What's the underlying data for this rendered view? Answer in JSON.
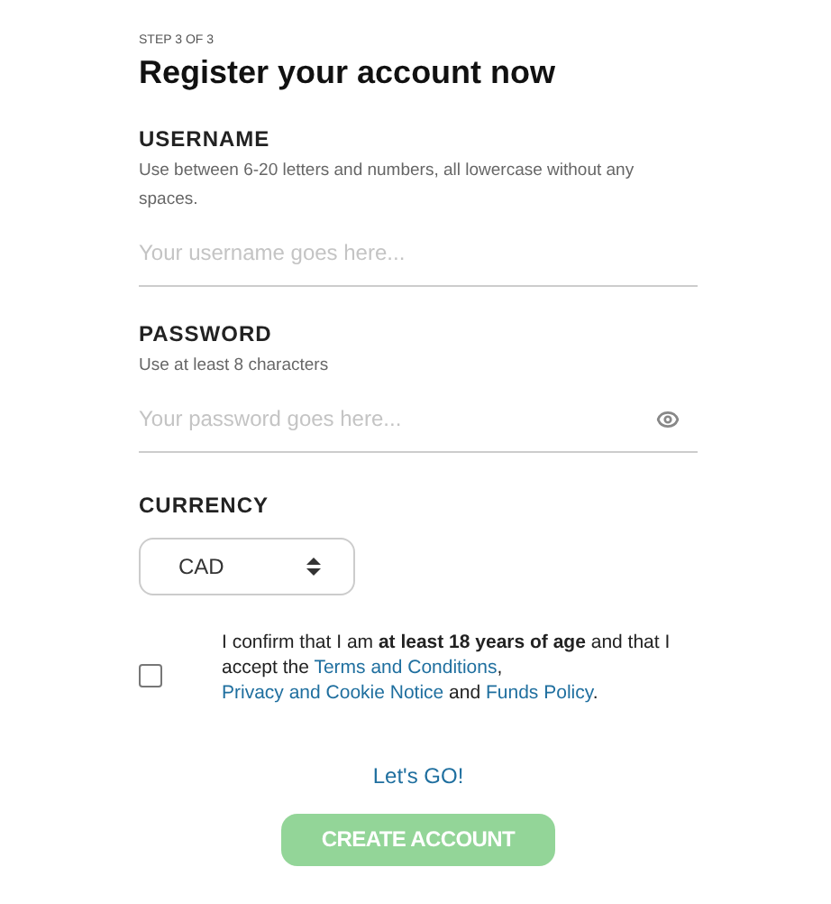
{
  "step": "STEP 3 OF 3",
  "title": "Register your account now",
  "username": {
    "label": "USERNAME",
    "hint": "Use between 6-20 letters and numbers, all lowercase without any spaces.",
    "placeholder": "Your username goes here..."
  },
  "password": {
    "label": "PASSWORD",
    "hint": "Use at least 8 characters",
    "placeholder": "Your password goes here..."
  },
  "currency": {
    "label": "CURRENCY",
    "value": "CAD"
  },
  "consent": {
    "checked": false,
    "parts": [
      {
        "kind": "text",
        "text": "I confirm that I am **at least 18 years of age** and that I accept the "
      },
      {
        "kind": "link",
        "text": "Terms and Conditions"
      },
      {
        "kind": "text",
        "text": ", "
      },
      {
        "kind": "link",
        "text": "Privacy and Cookie Notice"
      },
      {
        "kind": "text",
        "text": " and "
      },
      {
        "kind": "link",
        "text": "Funds Policy"
      },
      {
        "kind": "text",
        "text": "."
      }
    ]
  },
  "lets_go": "Let's GO!",
  "submit": {
    "label": "CREATE ACCOUNT",
    "disabled": true
  }
}
